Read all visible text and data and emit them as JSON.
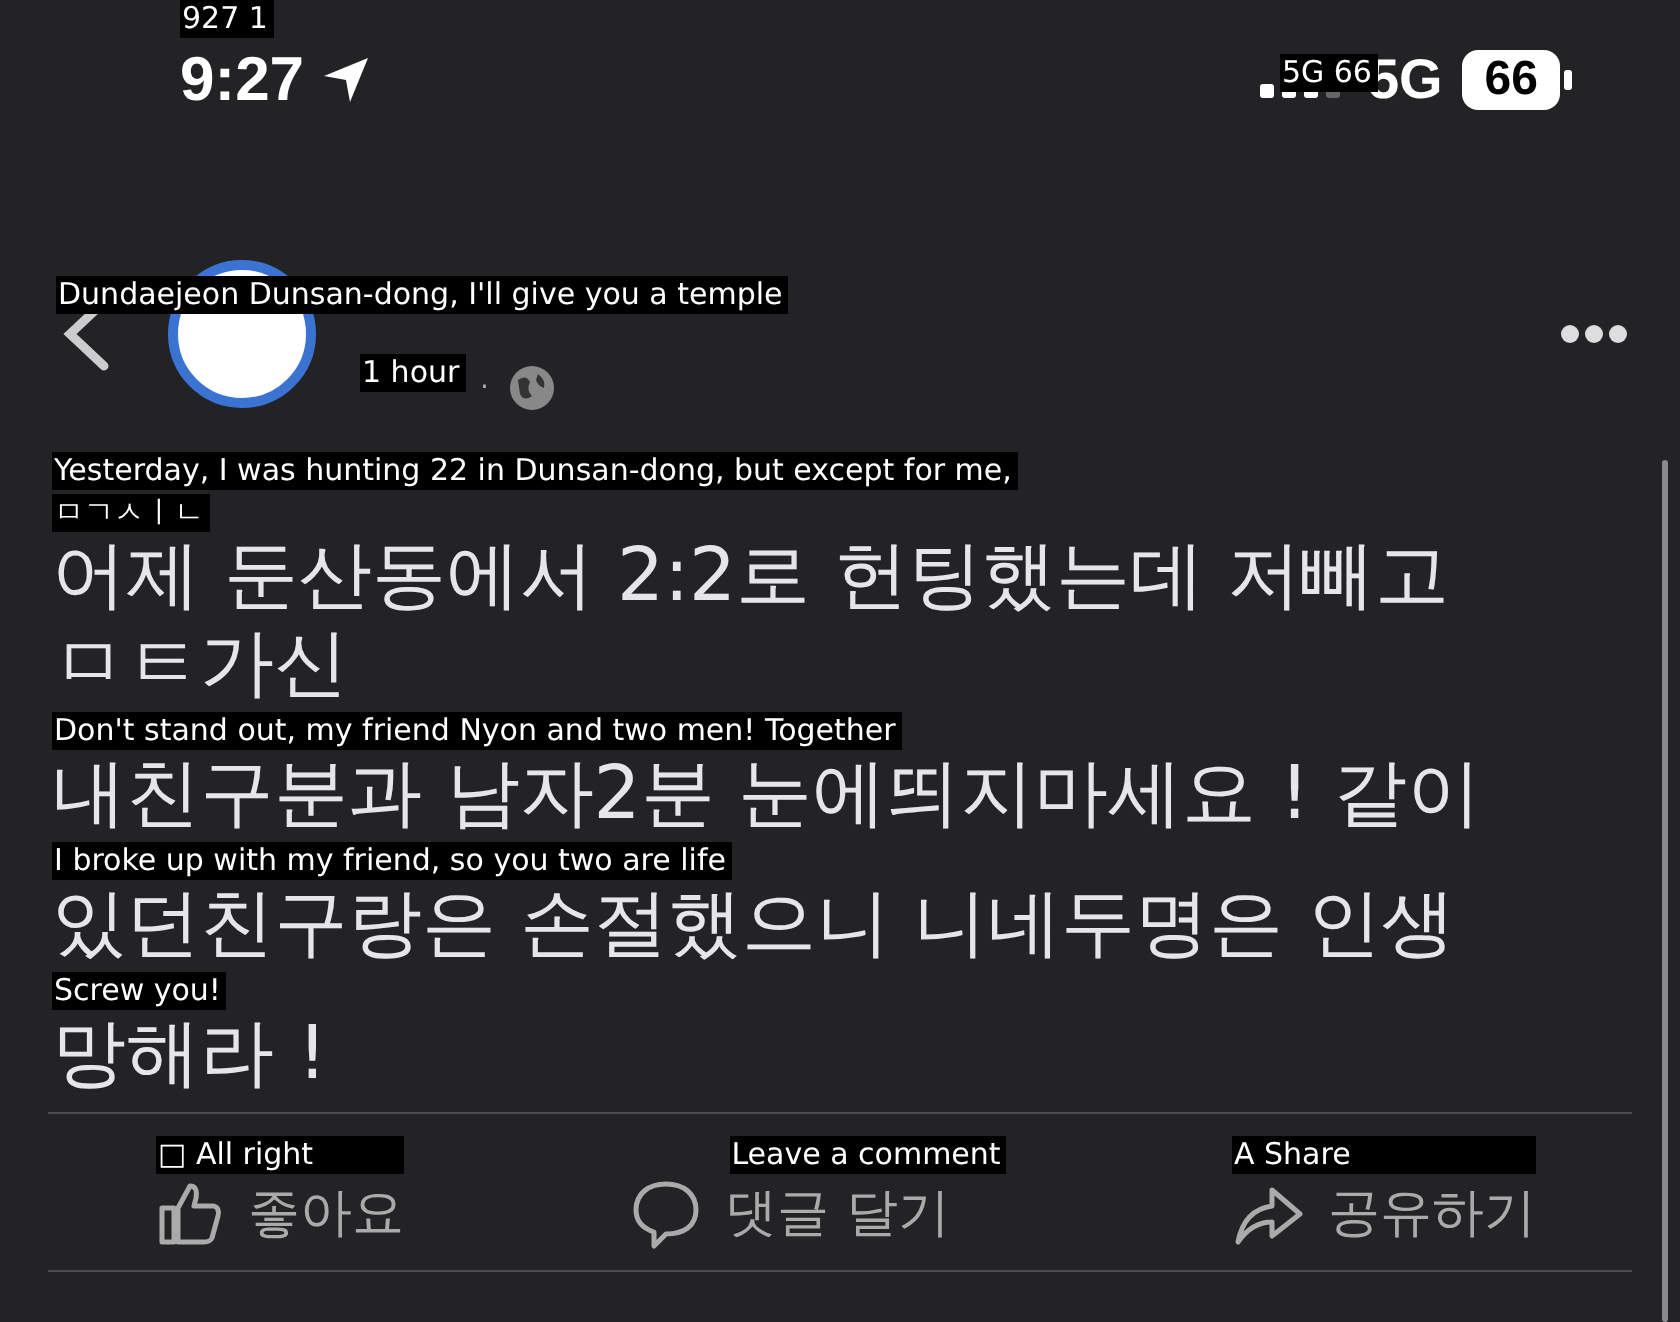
{
  "status_bar": {
    "time": "9:27",
    "time_translation": "927 1",
    "network": "5G",
    "network_translation": "5G 66",
    "battery": "66"
  },
  "post": {
    "author_translation": "Dundaejeon Dunsan-dong, I'll give you a temple",
    "time_translation": "1 hour",
    "separator": "·",
    "lines": [
      {
        "text": "어제 둔산동에서 2:2로 헌팅했는데 저빼고",
        "translations": [
          "Yesterday, I was hunting 22 in Dunsan-dong, but except for me,",
          "ㅁㄱㅅㅣㄴ"
        ]
      },
      {
        "text": "ㅁㅌ가신"
      },
      {
        "text": "내친구분과 남자2분 눈에띄지마세요 ! 같이",
        "translations": [
          "Don't stand out, my friend Nyon and two men! Together"
        ]
      },
      {
        "text": "있던친구랑은 손절했으니 니네두명은 인생",
        "translations": [
          "I broke up with my friend, so you two are life"
        ]
      },
      {
        "text": "망해라 !",
        "translations": [
          "Screw you!"
        ]
      }
    ]
  },
  "actions": [
    {
      "kind": "like",
      "label": "좋아요",
      "translation": "□ All right"
    },
    {
      "kind": "comment",
      "label": "댓글 달기",
      "translation": "Leave a comment"
    },
    {
      "kind": "share",
      "label": "공유하기",
      "translation": "A Share"
    }
  ]
}
